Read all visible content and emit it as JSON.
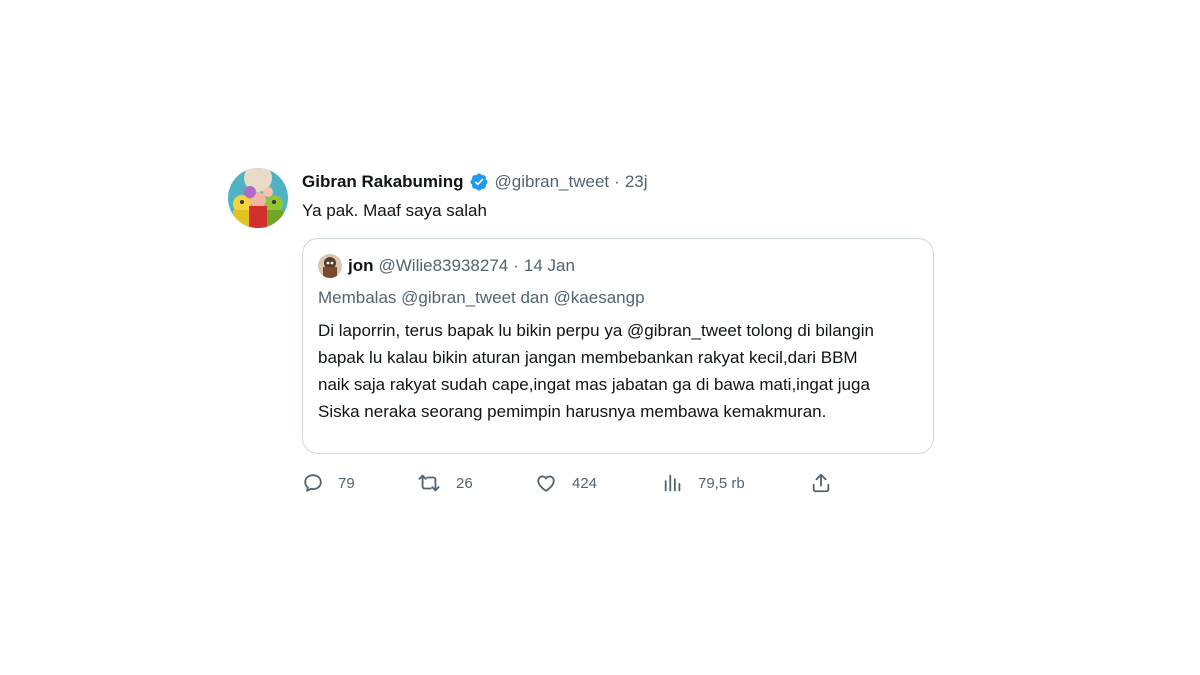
{
  "tweet": {
    "display_name": "Gibran Rakabuming",
    "handle": "@gibran_tweet",
    "separator": "·",
    "time": "23j",
    "text": "Ya pak. Maaf saya salah",
    "avatar_icon": "profile-photo-icon"
  },
  "quoted": {
    "display_name": "jon",
    "handle": "@Wilie83938274",
    "separator": "·",
    "time": "14 Jan",
    "reply_to": "Membalas @gibran_tweet dan @kaesangp",
    "text": "Di laporrin, terus bapak lu bikin perpu ya @gibran_tweet tolong di bilangin bapak lu kalau bikin aturan jangan membebankan rakyat kecil,dari BBM naik saja rakyat sudah cape,ingat mas jabatan ga di bawa mati,ingat juga Siska neraka seorang pemimpin harusnya membawa kemakmuran."
  },
  "actions": {
    "replies": "79",
    "retweets": "26",
    "likes": "424",
    "views": "79,5 rb"
  },
  "colors": {
    "text": "#0f1419",
    "secondary": "#536471",
    "verified": "#1d9bf0",
    "border": "#cfd9de"
  }
}
